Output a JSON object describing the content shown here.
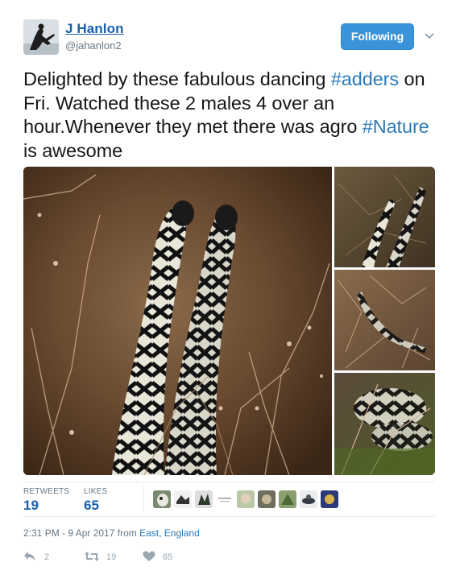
{
  "user": {
    "display_name": "J Hanlon",
    "handle": "@jahanlon2",
    "avatar_icon": "avatar-silhouette-photo"
  },
  "follow_button": {
    "label": "Following",
    "color": "#3b94d9"
  },
  "tweet": {
    "text_parts": [
      {
        "text": "Delighted by these fabulous dancing ",
        "kind": "plain"
      },
      {
        "text": "#adders",
        "kind": "hashtag"
      },
      {
        "text": " on Fri. Watched these 2 males 4 over an hour.Whenever they met there was agro ",
        "kind": "plain"
      },
      {
        "text": "#Nature",
        "kind": "hashtag"
      },
      {
        "text": " is awesome",
        "kind": "plain"
      }
    ],
    "hashtag_color": "#2b7bb9"
  },
  "media": {
    "photos": [
      {
        "name": "main-photo",
        "subject": "two adders rearing up among heather"
      },
      {
        "name": "thumb-1",
        "subject": "two adders dancing"
      },
      {
        "name": "thumb-2",
        "subject": "adder in dry heather"
      },
      {
        "name": "thumb-3",
        "subject": "coiled adder in moss"
      }
    ]
  },
  "stats": {
    "retweets_label": "RETWEETS",
    "retweets": "19",
    "likes_label": "LIKES",
    "likes": "65",
    "likers_count": 9
  },
  "meta": {
    "timestamp": "2:31 PM - 9 Apr 2017",
    "from_label": "from",
    "location": "East, England"
  },
  "actions": {
    "reply_icon": "reply-icon",
    "reply_count": "2",
    "retweet_icon": "retweet-icon",
    "retweet_count": "19",
    "like_icon": "heart-icon",
    "like_count": "65"
  }
}
